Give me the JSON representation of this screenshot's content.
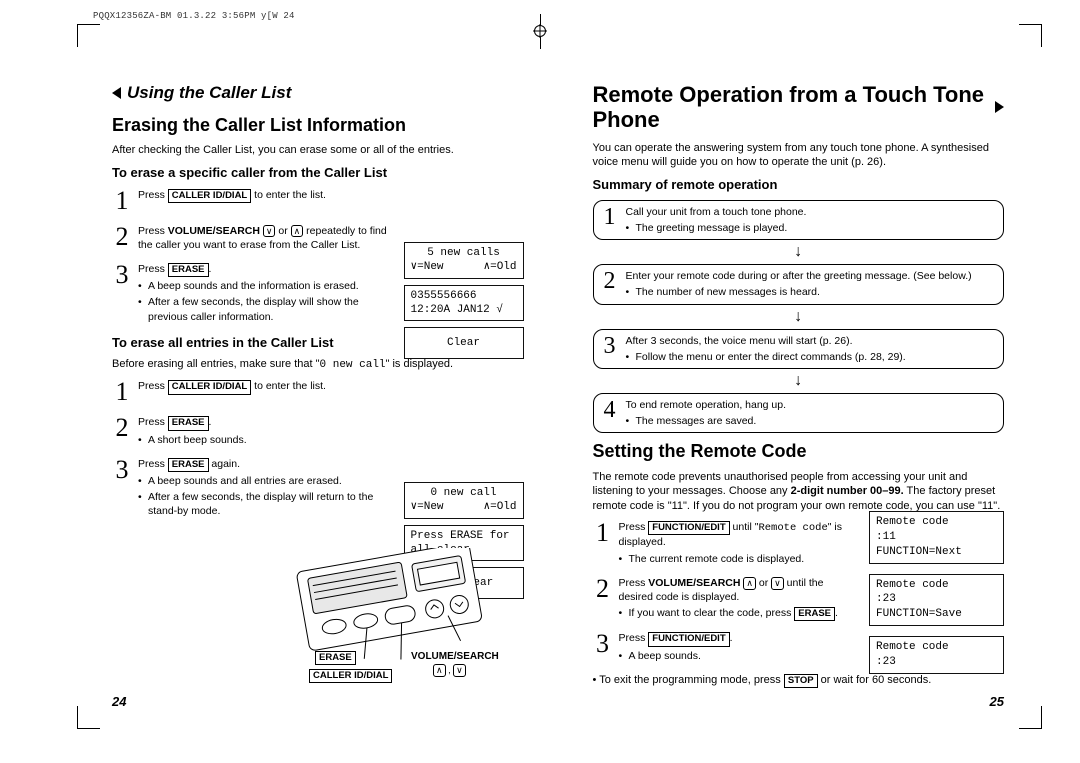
{
  "header_text": "PQQX12356ZA-BM 01.3.22 3:56PM y[W 24",
  "left": {
    "section": "Using the Caller List",
    "title": "Erasing the Caller List Information",
    "intro": "After checking the Caller List, you can erase some or all of the entries.",
    "sub1": "To erase a specific caller from the Caller List",
    "s1a_a": "Press ",
    "key_caller": "CALLER ID/DIAL",
    "s1a_b": " to enter the list.",
    "s2a_a": "Press ",
    "key_volsearch": "VOLUME/SEARCH",
    "s2a_b": " or ",
    "s2a_c": " repeatedly to find the caller you want to erase from the Caller List.",
    "s3a_a": "Press ",
    "key_erase": "ERASE",
    "s3a_b": ".",
    "s3a_bul1": "A beep sounds and the information is erased.",
    "s3a_bul2": "After a few seconds, the display will show the previous caller information.",
    "sub2": "To erase all entries in the Caller List",
    "intro2_a": "Before erasing all entries, make sure that \"",
    "intro2_code": "0 new call",
    "intro2_b": "\" is displayed.",
    "s1b": " to enter the list.",
    "s2b_a": "Press ",
    "s2b_b": ".",
    "s2b_bul": "A short beep sounds.",
    "s3b_a": "Press ",
    "s3b_b": " again.",
    "s3b_bul1": "A beep sounds and all entries are erased.",
    "s3b_bul2": "After a few seconds, the display will return to the stand-by mode.",
    "lcd1a_top": "5 new calls",
    "lcd1a_l": "∨=New",
    "lcd1a_r": "∧=Old",
    "lcd1b_top": "0355556666",
    "lcd1b_bot": "12:20A JAN12 √",
    "lcd1c": "Clear",
    "lcd2a_top": "0 new call",
    "lcd2a_l": "∨=New",
    "lcd2a_r": "∧=Old",
    "lcd2b_top": "Press ERASE for",
    "lcd2b_bot": "all clear",
    "lcd2c": "All clear",
    "dia_erase": "ERASE",
    "dia_caller": "CALLER ID/DIAL",
    "dia_vol": "VOLUME/SEARCH",
    "dia_arrows": "  , ",
    "pagenum": "24"
  },
  "right": {
    "big_title": "Remote Operation from a Touch Tone Phone",
    "intro": "You can operate the answering system from any touch tone phone. A synthesised voice menu will guide you on how to operate the unit (p. 26).",
    "summary": "Summary of remote operation",
    "b1a": "Call your unit from a touch tone phone.",
    "b1b": "The greeting message is played.",
    "b2a": "Enter your remote code during or after the greeting message. (See below.)",
    "b2b": "The number of new messages is heard.",
    "b3a": "After 3 seconds, the voice menu will start (p. 26).",
    "b3b": "Follow the menu or enter the direct commands (p. 28, 29).",
    "b4a": "To end remote operation, hang up.",
    "b4b": "The messages are saved.",
    "set_title": "Setting the Remote Code",
    "set_p_a": "The remote code prevents unauthorised people from accessing your unit and listening to your messages. Choose any ",
    "set_p_bold": "2-digit number 00–99.",
    "set_p_b": " The factory preset remote code is \"11\". If you do not program your own remote code, you can use \"11\".",
    "r1_a": "Press ",
    "key_func": "FUNCTION/EDIT",
    "r1_b": " until \"",
    "r1_code": "Remote code",
    "r1_c": "\" is displayed.",
    "r1_bul": "The current remote code is displayed.",
    "r2_a": "Press ",
    "r2_b": " or ",
    "r2_c": " until the desired code is displayed.",
    "r2_bul_a": "If you want to clear the code, press ",
    "r2_bul_b": ".",
    "r3_a": "Press ",
    "r3_b": ".",
    "r3_bul": "A beep sounds.",
    "exit_a": "To exit the programming mode, press ",
    "key_stop": "STOP",
    "exit_b": " or wait for 60 seconds.",
    "lcdA1": "Remote code",
    "lcdA2": ":11",
    "lcdA3": " FUNCTION=Next",
    "lcdB1": "Remote code",
    "lcdB2": ":23",
    "lcdB3": " FUNCTION=Save",
    "lcdC1": "Remote code",
    "lcdC2": ":23",
    "pagenum": "25"
  }
}
